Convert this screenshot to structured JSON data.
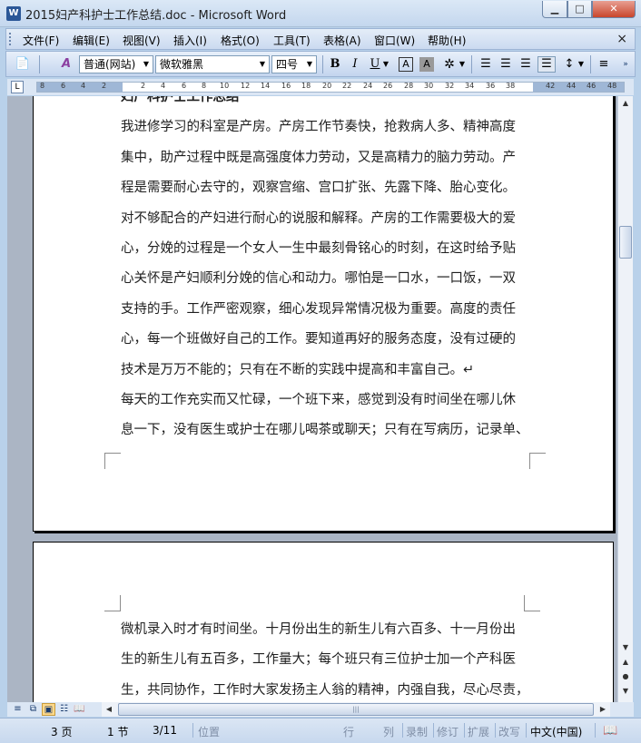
{
  "window": {
    "icon": "W",
    "title": "2015妇产科护士工作总结.doc - Microsoft Word",
    "min": "▁",
    "max": "□",
    "close": "✕"
  },
  "menu": {
    "items": [
      "文件(F)",
      "编辑(E)",
      "视图(V)",
      "插入(I)",
      "格式(O)",
      "工具(T)",
      "表格(A)",
      "窗口(W)",
      "帮助(H)"
    ],
    "close": "×"
  },
  "toolbar": {
    "style": "普通(网站)",
    "font": "微软雅黑",
    "size": "四号",
    "bold": "B",
    "italic": "I",
    "underline": "U"
  },
  "ruler": {
    "corner": "L",
    "left_ticks": [
      "8",
      "6",
      "4",
      "2"
    ],
    "ticks": [
      "2",
      "4",
      "6",
      "8",
      "10",
      "12",
      "14",
      "16",
      "18",
      "20",
      "22",
      "24",
      "26",
      "28",
      "30",
      "32",
      "34",
      "36",
      "38"
    ],
    "right_ticks": [
      "42",
      "44",
      "46",
      "48"
    ]
  },
  "document": {
    "heading": "妇产科护士工作总结",
    "page1_lines": [
      "我进修学习的科室是产房。产房工作节奏快，抢救病人多、精神高度",
      "集中，助产过程中既是高强度体力劳动，又是高精力的脑力劳动。产",
      "程是需要耐心去守的，观察宫缩、宫口扩张、先露下降、胎心变化。",
      "对不够配合的产妇进行耐心的说服和解释。产房的工作需要极大的爱",
      "心，分娩的过程是一个女人一生中最刻骨铭心的时刻，在这时给予贴",
      "心关怀是产妇顺利分娩的信心和动力。哪怕是一口水，一口饭，一双",
      "支持的手。工作严密观察，细心发现异常情况极为重要。高度的责任",
      "心，每一个班做好自己的工作。要知道再好的服务态度，没有过硬的",
      "技术是万万不能的；只有在不断的实践中提高和丰富自己。↵",
      "每天的工作充实而又忙碌，一个班下来，感觉到没有时间坐在哪儿休",
      "息一下，没有医生或护士在哪儿喝茶或聊天；只有在写病历，记录单、"
    ],
    "page2_lines": [
      "微机录入时才有时间坐。十月份出生的新生儿有六百多、十一月份出",
      "生的新生儿有五百多，工作量大；每个班只有三位护士加一个产科医",
      "生，共同协作，工作时大家发扬主人翁的精神，内强自我，尽心尽责，"
    ]
  },
  "status": {
    "page": "3 页",
    "section": "1 节",
    "page_of": "3/11",
    "position": "位置",
    "line": "行",
    "column": "列",
    "record": "录制",
    "revise": "修订",
    "extend": "扩展",
    "overwrite": "改写",
    "language": "中文(中国)"
  }
}
